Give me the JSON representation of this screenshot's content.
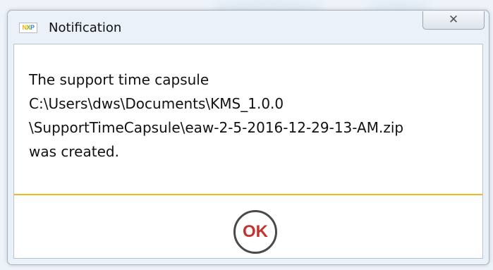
{
  "window": {
    "title": "Notification",
    "app_icon_letters": [
      "N",
      "X",
      "P"
    ],
    "close_glyph": "✕"
  },
  "message": {
    "lines": [
      "The support time capsule",
      "C:\\Users\\dws\\Documents\\KMS_1.0.0",
      "\\SupportTimeCapsule\\eaw-2-5-2016-12-29-13-AM.zip",
      "was created."
    ]
  },
  "buttons": {
    "ok_label": "OK"
  },
  "colors": {
    "divider": "#f1b71e",
    "ok_text": "#c6312b"
  }
}
